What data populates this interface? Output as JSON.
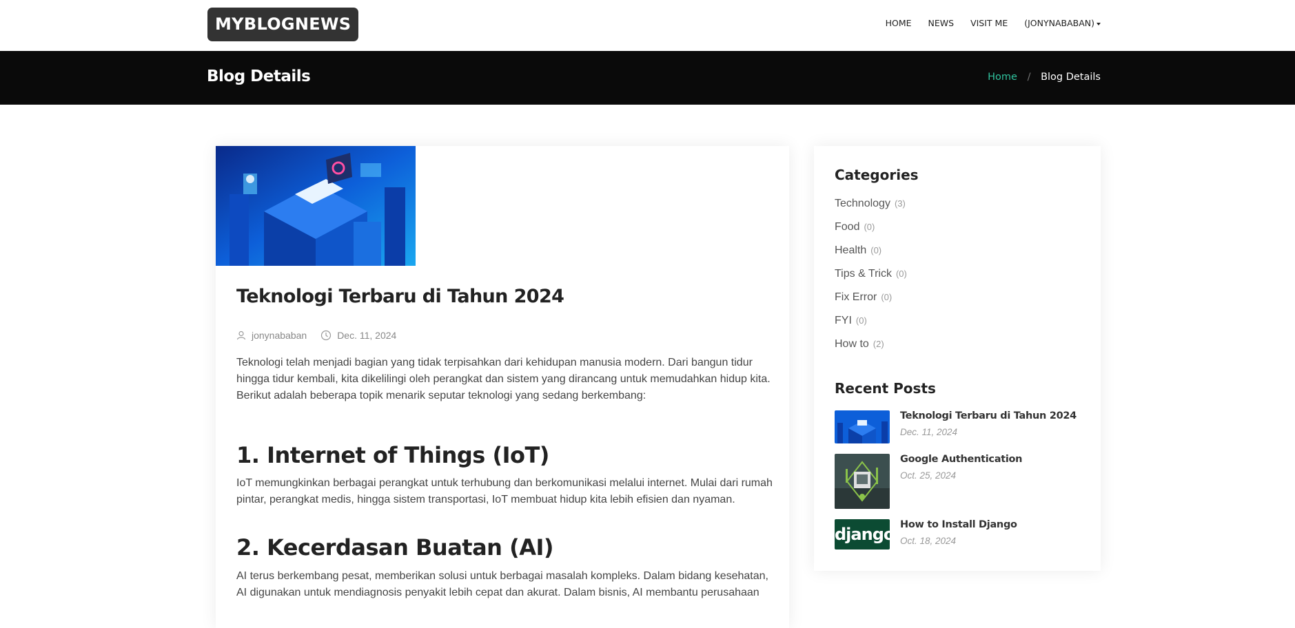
{
  "header": {
    "logo": "MYBLOGNEWS",
    "nav": [
      "HOME",
      "NEWS",
      "VISIT ME",
      "(JONYNABABAN)"
    ]
  },
  "band": {
    "title": "Blog Details",
    "crumb_home": "Home",
    "crumb_sep": "/",
    "crumb_current": "Blog Details"
  },
  "article": {
    "title": "Teknologi Terbaru di Tahun 2024",
    "author": "jonynababan",
    "date": "Dec. 11, 2024",
    "intro": "Teknologi telah menjadi bagian yang tidak terpisahkan dari kehidupan manusia modern. Dari bangun tidur hingga tidur kembali, kita dikelilingi oleh perangkat dan sistem yang dirancang untuk memudahkan hidup kita. Berikut adalah beberapa topik menarik seputar teknologi yang sedang berkembang:",
    "section1_title": "1. Internet of Things (IoT)",
    "section1_body": "IoT memungkinkan berbagai perangkat untuk terhubung dan berkomunikasi melalui internet. Mulai dari rumah pintar, perangkat medis, hingga sistem transportasi, IoT membuat hidup kita lebih efisien dan nyaman.",
    "section2_title": "2. Kecerdasan Buatan (AI)",
    "section2_body": "AI terus berkembang pesat, memberikan solusi untuk berbagai masalah kompleks. Dalam bidang kesehatan, AI digunakan untuk mendiagnosis penyakit lebih cepat dan akurat. Dalam bisnis, AI membantu perusahaan"
  },
  "sidebar": {
    "categories_title": "Categories",
    "categories": [
      {
        "name": "Technology",
        "count": "(3)"
      },
      {
        "name": "Food",
        "count": "(0)"
      },
      {
        "name": "Health",
        "count": "(0)"
      },
      {
        "name": "Tips & Trick",
        "count": "(0)"
      },
      {
        "name": "Fix Error",
        "count": "(0)"
      },
      {
        "name": "FYI",
        "count": "(0)"
      },
      {
        "name": "How to",
        "count": "(2)"
      }
    ],
    "recent_title": "Recent Posts",
    "recent": [
      {
        "title": "Teknologi Terbaru di Tahun 2024",
        "date": "Dec. 11, 2024"
      },
      {
        "title": "Google Authentication",
        "date": "Oct. 25, 2024"
      },
      {
        "title": "How to Install Django",
        "date": "Oct. 18, 2024",
        "thumb_text": "django"
      }
    ]
  },
  "colors": {
    "accent": "#30c39e",
    "band_bg": "#0a0a0a",
    "logo_bg": "#333333"
  }
}
